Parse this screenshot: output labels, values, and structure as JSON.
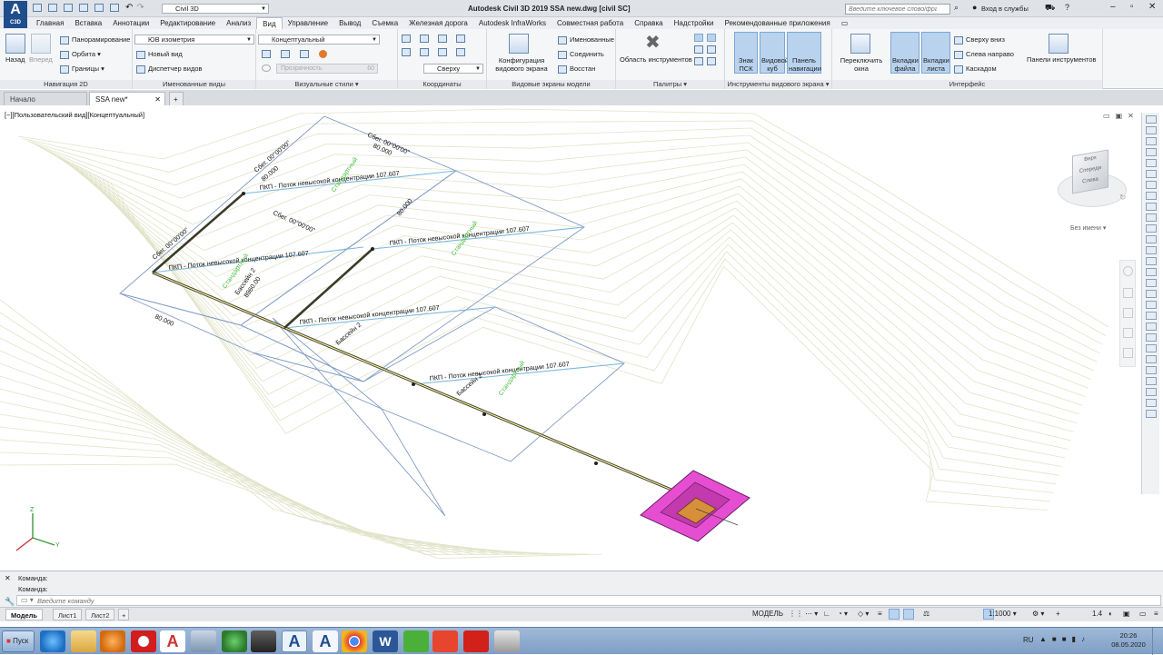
{
  "app": {
    "title": "Autodesk Civil 3D 2019   SSA new.dwg [civil SC]",
    "logo_text": "A",
    "logo_sub": "C3D",
    "workspace": "Civil 3D",
    "search_placeholder": "Введите ключевое слово/фразу",
    "signin": "Вход в службы"
  },
  "menu_tabs": [
    "Главная",
    "Вставка",
    "Аннотации",
    "Редактирование",
    "Анализ",
    "Вид",
    "Управление",
    "Вывод",
    "Съемка",
    "Железная дорога",
    "Autodesk InfraWorks",
    "Совместная работа",
    "Справка",
    "Надстройки",
    "Рекомендованные приложения"
  ],
  "active_tab": "Вид",
  "ribbon": {
    "nav2d": {
      "label": "Навигация 2D",
      "back": "Назад",
      "forward": "Вперед",
      "pan": "Панорамирование",
      "orbit": "Орбита",
      "extents": "Границы"
    },
    "named_views": {
      "label": "Именованные виды",
      "view_select": "ЮВ изометрия",
      "new_view": "Новый вид",
      "view_manager": "Диспетчер видов"
    },
    "visual_styles": {
      "label": "Визуальные стили",
      "style_select": "Концептуальный",
      "transparency": "Прозрачность",
      "transparency_value": "60"
    },
    "coords": {
      "label": "Координаты",
      "ucs_select": "Сверху"
    },
    "viewports": {
      "label": "Видовые экраны модели",
      "config": "Конфигурация видового экрана",
      "named": "Именованные",
      "join": "Соединить",
      "restore": "Восстан"
    },
    "palettes": {
      "label": "Палитры",
      "tool_area": "Область инструментов"
    },
    "viewport_tools": {
      "label": "Инструменты видового экрана",
      "ucs_icon": "Знак ПСК",
      "view_cube": "Видовой куб",
      "nav_bar": "Панель навигации"
    },
    "interface": {
      "label": "Интерфейс",
      "switch_windows": "Переключить окна",
      "file_tabs": "Вкладки файла",
      "layout_tabs": "Вкладки листа",
      "tile_h": "Сверху вниз",
      "tile_v": "Слева направо",
      "cascade": "Каскадом",
      "toolbars": "Панели инструментов"
    }
  },
  "file_tabs": [
    "Начало",
    "SSA new*"
  ],
  "viewport_label": "[−][Пользовательский вид][Концептуальный]",
  "viewcube": {
    "top": "Верх",
    "front": "Спереди",
    "right": "Слева",
    "ucs_name": "Без имени"
  },
  "drawing": {
    "flow_label": "ПКП - Поток невысокой концентрации 107.607",
    "slope_label": "Сбег. 00°00'00\"",
    "length_label": "80.000",
    "basin_label": "Бассейн 2",
    "area_label": "8960.00",
    "green_label": "Стандартный"
  },
  "command": {
    "line1": "Команда:",
    "line2": "Команда:",
    "placeholder": "Введите команду"
  },
  "layout_tabs": [
    "Модель",
    "Лист1",
    "Лист2"
  ],
  "status": {
    "model": "МОДЕЛЬ",
    "scale": "1:1000",
    "zoom": "1.4"
  },
  "taskbar": {
    "start": "Пуск",
    "lang": "RU",
    "time": "20:26",
    "date": "08.05.2020"
  }
}
